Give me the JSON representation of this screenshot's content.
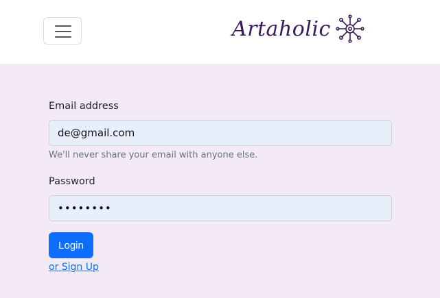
{
  "navbar": {
    "toggler_icon": "hamburger-menu-icon",
    "brand_text": "Artaholic",
    "logo_icon": "flower-splash-logo-icon",
    "brand_color": "#3a1a5a"
  },
  "form": {
    "email_label": "Email address",
    "email_value": "de@gmail.com",
    "email_help": "We'll never share your email with anyone else.",
    "password_label": "Password",
    "password_value": "••••••••",
    "login_label": "Login",
    "signup_link": "or Sign Up"
  },
  "colors": {
    "page_background": "#f3eaf6",
    "input_background": "#e8effb",
    "primary": "#0d6efd"
  }
}
